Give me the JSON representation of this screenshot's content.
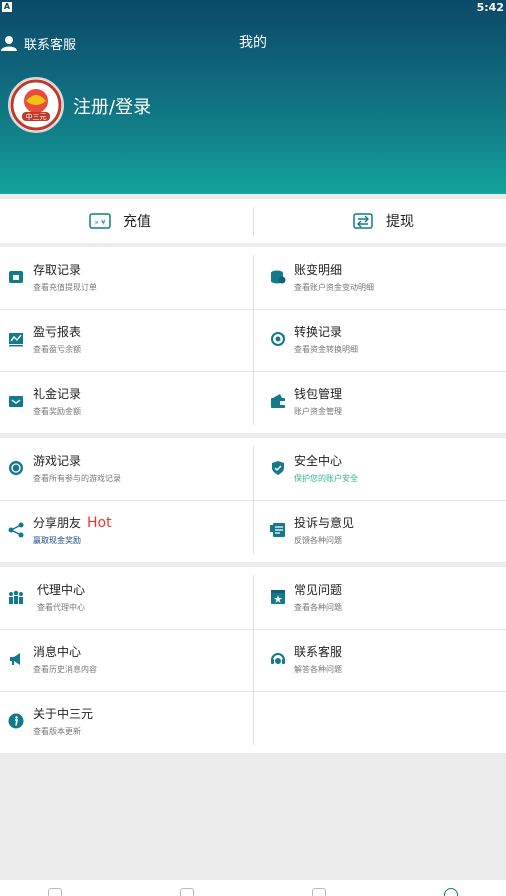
{
  "status": {
    "badge": "A",
    "time": "5:42"
  },
  "header": {
    "customer_service": "联系客服",
    "title": "我的",
    "login": "注册/登录",
    "logo_text": "中三元"
  },
  "wallet": {
    "recharge": "充值",
    "withdraw": "提现",
    "recharge_icon_text": "» ¥"
  },
  "menu": {
    "g1": [
      {
        "title": "存取记录",
        "sub": "查看充值提现订单"
      },
      {
        "title": "账变明细",
        "sub": "查看账户资金变动明细"
      },
      {
        "title": "盈亏报表",
        "sub": "查看盈亏余额"
      },
      {
        "title": "转换记录",
        "sub": "查看资金转换明细"
      },
      {
        "title": "礼金记录",
        "sub": "查看奖励金额"
      },
      {
        "title": "钱包管理",
        "sub": "账户资金管理"
      }
    ],
    "g2": [
      {
        "title": "游戏记录",
        "sub": "查看所有参与的游戏记录"
      },
      {
        "title": "安全中心",
        "sub": "保护您的账户安全"
      },
      {
        "title": "分享朋友",
        "hot": "Hot",
        "sub": "赢取现金奖励"
      },
      {
        "title": "投诉与意见",
        "sub": "反馈各种问题"
      }
    ],
    "g3": [
      {
        "title": "代理中心",
        "sub": "查看代理中心"
      },
      {
        "title": "常见问题",
        "sub": "查看各种问题"
      },
      {
        "title": "消息中心",
        "sub": "查看历史消息内容"
      },
      {
        "title": "联系客服",
        "sub": "解答各种问题"
      },
      {
        "title": "关于中三元",
        "sub": "查看版本更新"
      }
    ]
  },
  "colors": {
    "accent": "#0f6b87",
    "icon": "#137a8c",
    "green": "#2fb38f",
    "hot": "#ee3333"
  }
}
